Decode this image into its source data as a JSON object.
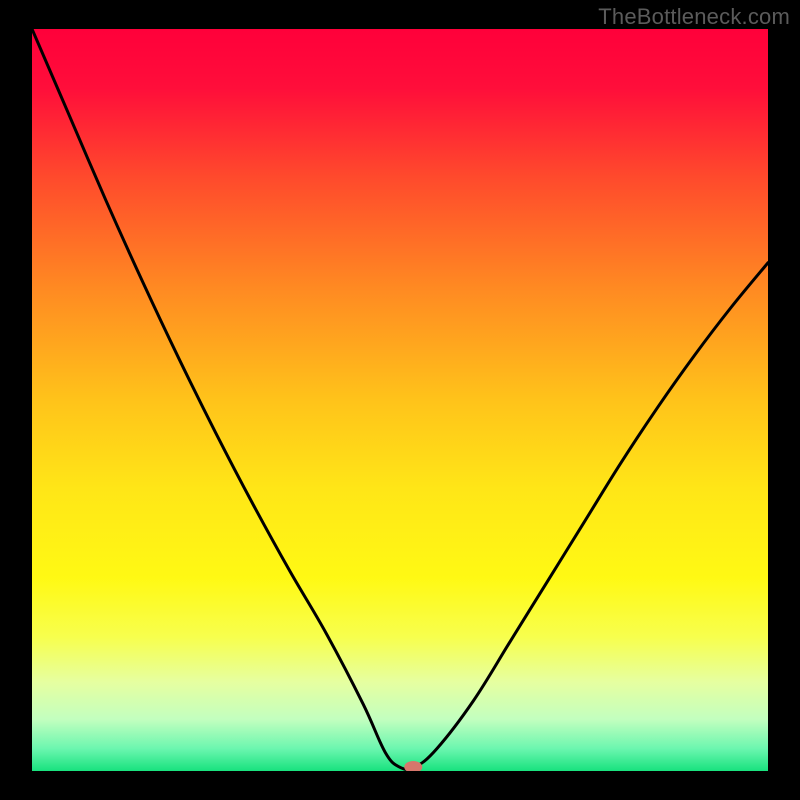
{
  "watermark": "TheBottleneck.com",
  "chart_data": {
    "type": "line",
    "title": "",
    "xlabel": "",
    "ylabel": "",
    "xlim": [
      0,
      1
    ],
    "ylim": [
      0,
      1
    ],
    "x": [
      0.0,
      0.05,
      0.1,
      0.15,
      0.2,
      0.25,
      0.3,
      0.35,
      0.4,
      0.45,
      0.48,
      0.5,
      0.52,
      0.55,
      0.6,
      0.65,
      0.7,
      0.75,
      0.8,
      0.85,
      0.9,
      0.95,
      1.0
    ],
    "values": [
      1.0,
      0.885,
      0.77,
      0.66,
      0.555,
      0.455,
      0.36,
      0.27,
      0.185,
      0.09,
      0.025,
      0.005,
      0.005,
      0.03,
      0.095,
      0.175,
      0.255,
      0.335,
      0.415,
      0.49,
      0.56,
      0.625,
      0.685
    ],
    "marker": {
      "x": 0.518,
      "y": 0.0,
      "color": "#d6766c"
    },
    "background_gradient": {
      "stops": [
        {
          "pos": 0.0,
          "color": "#ff003a"
        },
        {
          "pos": 0.08,
          "color": "#ff0e3a"
        },
        {
          "pos": 0.2,
          "color": "#ff4a2c"
        },
        {
          "pos": 0.35,
          "color": "#ff8a22"
        },
        {
          "pos": 0.5,
          "color": "#ffc31a"
        },
        {
          "pos": 0.62,
          "color": "#ffe617"
        },
        {
          "pos": 0.74,
          "color": "#fff914"
        },
        {
          "pos": 0.82,
          "color": "#f7ff4e"
        },
        {
          "pos": 0.88,
          "color": "#e6ffa0"
        },
        {
          "pos": 0.93,
          "color": "#c3ffbf"
        },
        {
          "pos": 0.97,
          "color": "#6bf6af"
        },
        {
          "pos": 1.0,
          "color": "#18e27e"
        }
      ]
    }
  }
}
